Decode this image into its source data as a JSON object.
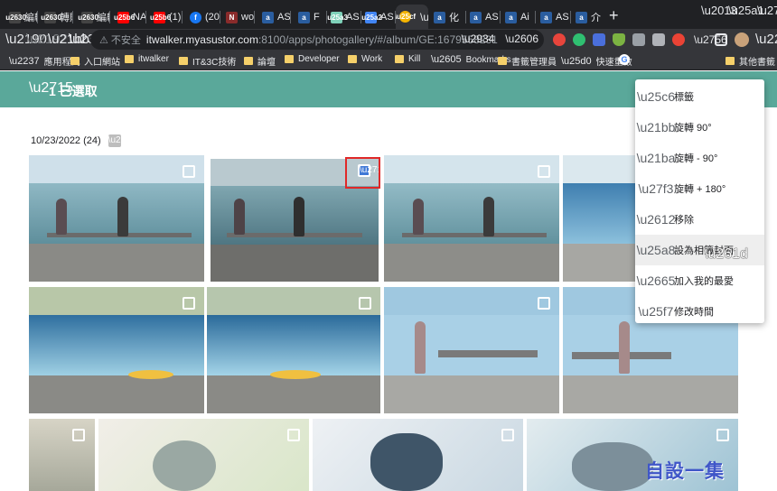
{
  "browser": {
    "tabs": [
      {
        "label": "編輯",
        "color": "#ffffff"
      },
      {
        "label": "轉貼",
        "color": "#ffffff"
      },
      {
        "label": "編輯",
        "color": "#ffffff"
      },
      {
        "label": "NA",
        "color": "#ff0000"
      },
      {
        "label": "(1)",
        "color": "#ff0000"
      },
      {
        "label": "(20",
        "color": "#1877f2"
      },
      {
        "label": "wo",
        "color": "#ffffff"
      },
      {
        "label": "AS",
        "color": "#5aa7e8"
      },
      {
        "label": "F",
        "color": "#5aa7e8"
      },
      {
        "label": "AS",
        "color": "#7fd1b9"
      },
      {
        "label": "AS",
        "color": "#4285f4"
      },
      {
        "label": "",
        "color": "#f4b400"
      },
      {
        "label": "化",
        "color": "#5aa7e8"
      },
      {
        "label": "AS",
        "color": "#5aa7e8"
      },
      {
        "label": "Ai",
        "color": "#5aa7e8"
      },
      {
        "label": "AS",
        "color": "#5aa7e8"
      },
      {
        "label": "介",
        "color": "#5aa7e8"
      }
    ],
    "new_tab": "+",
    "url_warning": "⚠ 不安全",
    "url_host": "itwalker.myasustor.com",
    "url_rest": ":8100/apps/photogallery/#/album/GE:1679558231",
    "bookmarks": [
      "應用程式",
      "入口網站",
      "itwalker",
      "IT&3C技術",
      "論壇",
      "Developer",
      "Work",
      "Kill",
      "Bookmarks",
      "書籤管理員",
      "快速重啟",
      "其他書籤"
    ]
  },
  "app": {
    "selection_title": "1 已選取",
    "accent": "#5aa89a",
    "date_group": "10/23/2022 (24)",
    "selected_check_color": "#3f78d6"
  },
  "menu": {
    "items": [
      {
        "label": "標籤",
        "icon": "tag-icon"
      },
      {
        "label": "旋轉 90°",
        "icon": "rotate-right-icon"
      },
      {
        "label": "旋轉 - 90°",
        "icon": "rotate-left-icon"
      },
      {
        "label": "旋轉 + 180°",
        "icon": "rotate-180-icon"
      },
      {
        "label": "移除",
        "icon": "remove-photo-icon"
      },
      {
        "label": "設為相簿封面",
        "icon": "image-icon"
      },
      {
        "label": "加入我的最愛",
        "icon": "heart-icon"
      },
      {
        "label": "修改時間",
        "icon": "clock-edit-icon"
      }
    ],
    "hovered_index": 5
  },
  "watermark": "自設一集"
}
